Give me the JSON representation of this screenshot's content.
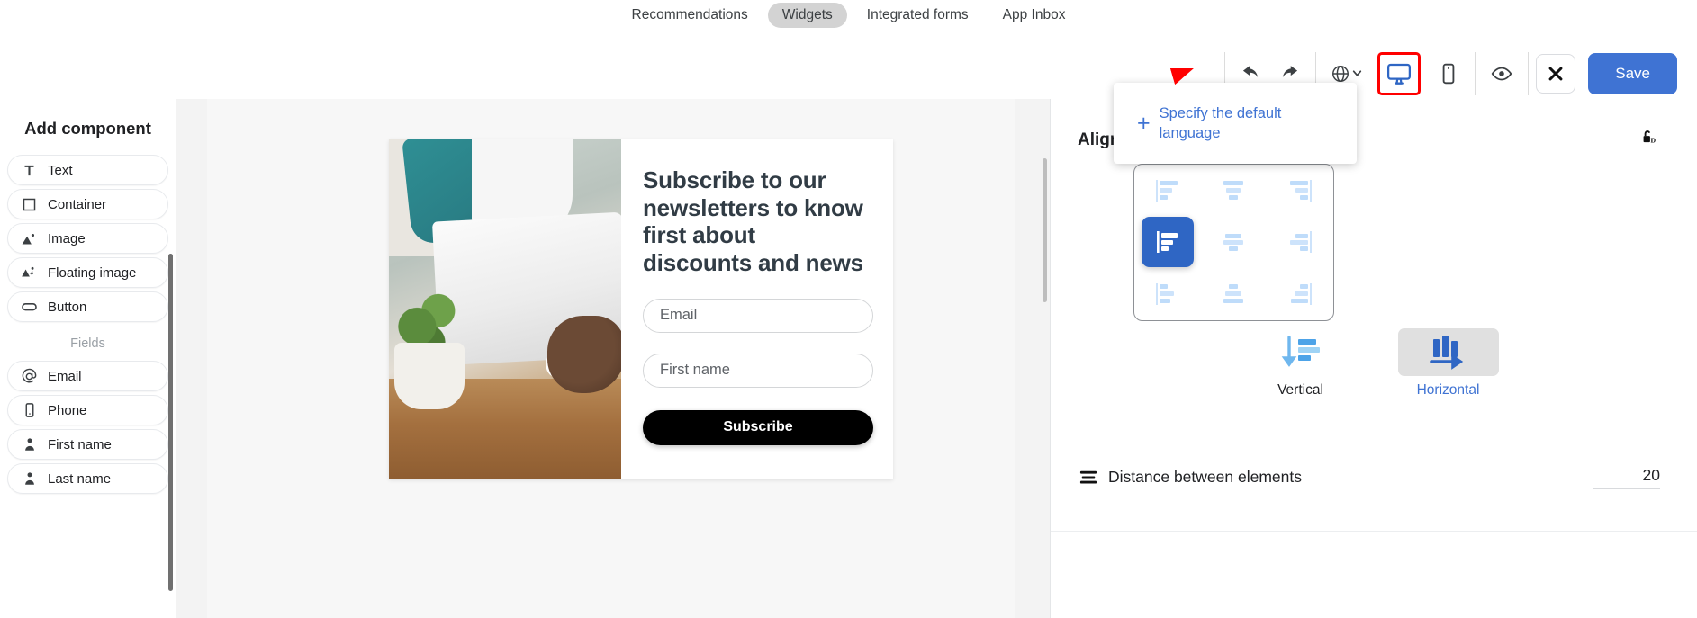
{
  "topnav": {
    "items": [
      {
        "label": "Recommendations",
        "active": false
      },
      {
        "label": "Widgets",
        "active": true
      },
      {
        "label": "Integrated forms",
        "active": false
      },
      {
        "label": "App Inbox",
        "active": false
      }
    ]
  },
  "toolbar": {
    "undo": "undo-arrow",
    "redo": "redo-arrow",
    "language": "globe-language",
    "desktop": "desktop-monitor",
    "mobile": "mobile-phone",
    "preview": "eye-preview",
    "close": "close-x",
    "save_label": "Save",
    "accent_color": "#3f73d3",
    "highlight_color": "#ff0000"
  },
  "popup": {
    "plus": "+",
    "text": "Specify the default language",
    "link_color": "#3f73d3"
  },
  "sidebar": {
    "title": "Add component",
    "components": [
      {
        "label": "Text",
        "icon": "text-icon"
      },
      {
        "label": "Container",
        "icon": "container-icon"
      },
      {
        "label": "Image",
        "icon": "image-icon"
      },
      {
        "label": "Floating image",
        "icon": "floating-image-icon"
      },
      {
        "label": "Button",
        "icon": "button-icon"
      }
    ],
    "fields_label": "Fields",
    "fields": [
      {
        "label": "Email",
        "icon": "at-icon"
      },
      {
        "label": "Phone",
        "icon": "phone-icon"
      },
      {
        "label": "First name",
        "icon": "person-icon"
      },
      {
        "label": "Last name",
        "icon": "person-icon"
      }
    ]
  },
  "widget": {
    "title": "Subscribe to our newsletters to know first about discounts and news",
    "fields": [
      {
        "placeholder": "Email"
      },
      {
        "placeholder": "First name"
      }
    ],
    "button_label": "Subscribe",
    "button_color": "#000000"
  },
  "rightpanel": {
    "title": "Align",
    "lock_icon": "unlock-icon",
    "align_grid": {
      "cells": [
        {
          "name": "top-left",
          "selected": false
        },
        {
          "name": "top-center",
          "selected": false
        },
        {
          "name": "top-right",
          "selected": false
        },
        {
          "name": "middle-left",
          "selected": true
        },
        {
          "name": "middle-center",
          "selected": false
        },
        {
          "name": "middle-right",
          "selected": false
        },
        {
          "name": "bottom-left",
          "selected": false
        },
        {
          "name": "bottom-center",
          "selected": false
        },
        {
          "name": "bottom-right",
          "selected": false
        }
      ]
    },
    "orientation": [
      {
        "label": "Vertical",
        "active": false
      },
      {
        "label": "Horizontal",
        "active": true
      }
    ],
    "distance": {
      "label": "Distance between elements",
      "value": "20"
    }
  }
}
